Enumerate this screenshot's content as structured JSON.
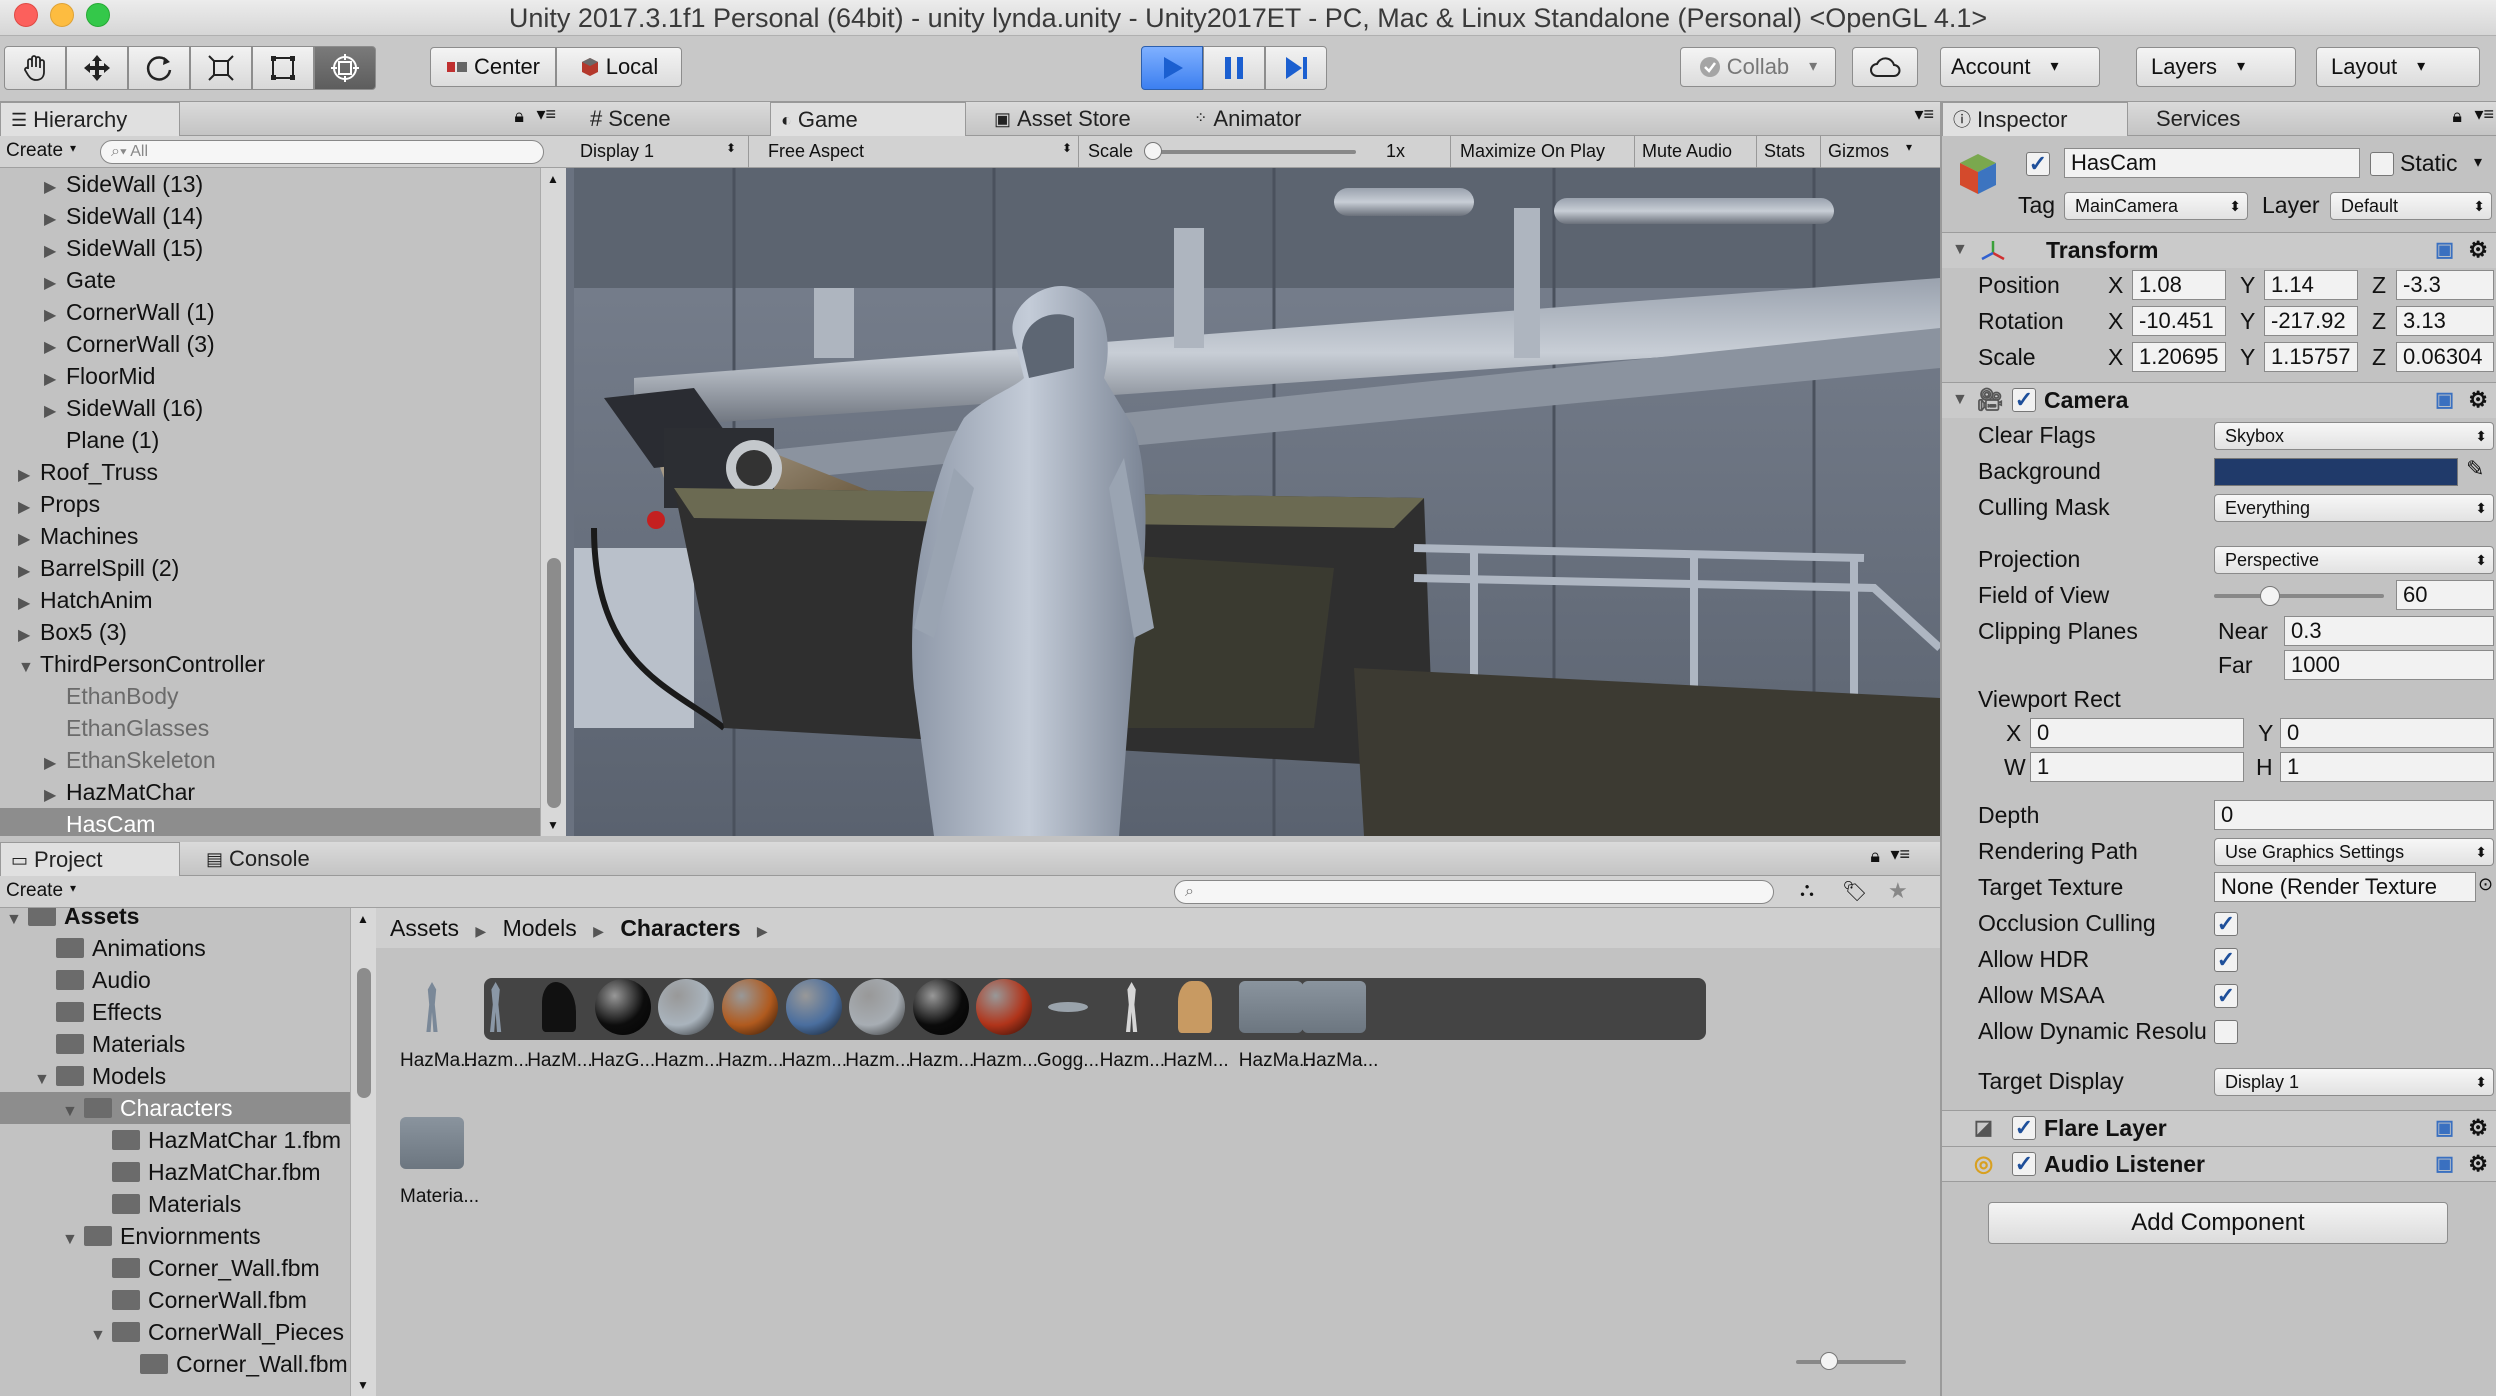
{
  "window": {
    "title": "Unity 2017.3.1f1 Personal (64bit) - unity lynda.unity - Unity2017ET - PC, Mac & Linux Standalone (Personal) <OpenGL 4.1>"
  },
  "toolbar": {
    "pivot_center": "Center",
    "pivot_local": "Local",
    "collab": "Collab",
    "account": "Account",
    "layers": "Layers",
    "layout": "Layout"
  },
  "hierarchy": {
    "tab": "Hierarchy",
    "create": "Create",
    "search_placeholder": "All",
    "items": [
      {
        "label": "SideWall (13)",
        "indent": 1,
        "arrow": true,
        "dim": false
      },
      {
        "label": "SideWall (14)",
        "indent": 1,
        "arrow": true,
        "dim": false
      },
      {
        "label": "SideWall (15)",
        "indent": 1,
        "arrow": true,
        "dim": false
      },
      {
        "label": "Gate",
        "indent": 1,
        "arrow": true,
        "dim": false
      },
      {
        "label": "CornerWall (1)",
        "indent": 1,
        "arrow": true,
        "dim": false
      },
      {
        "label": "CornerWall (3)",
        "indent": 1,
        "arrow": true,
        "dim": false
      },
      {
        "label": "FloorMid",
        "indent": 1,
        "arrow": true,
        "dim": false
      },
      {
        "label": "SideWall (16)",
        "indent": 1,
        "arrow": true,
        "dim": false
      },
      {
        "label": "Plane (1)",
        "indent": 1,
        "arrow": false,
        "dim": false
      },
      {
        "label": "Roof_Truss",
        "indent": 0,
        "arrow": true,
        "dim": false
      },
      {
        "label": "Props",
        "indent": 0,
        "arrow": true,
        "dim": false
      },
      {
        "label": "Machines",
        "indent": 0,
        "arrow": true,
        "dim": false
      },
      {
        "label": "BarrelSpill (2)",
        "indent": 0,
        "arrow": true,
        "dim": false
      },
      {
        "label": "HatchAnim",
        "indent": 0,
        "arrow": true,
        "dim": false
      },
      {
        "label": "Box5 (3)",
        "indent": 0,
        "arrow": true,
        "dim": false
      },
      {
        "label": "ThirdPersonController",
        "indent": 0,
        "arrow": true,
        "open": true,
        "dim": false
      },
      {
        "label": "EthanBody",
        "indent": 1,
        "arrow": false,
        "dim": true
      },
      {
        "label": "EthanGlasses",
        "indent": 1,
        "arrow": false,
        "dim": true
      },
      {
        "label": "EthanSkeleton",
        "indent": 1,
        "arrow": true,
        "dim": true
      },
      {
        "label": "HazMatChar",
        "indent": 1,
        "arrow": true,
        "dim": false
      },
      {
        "label": "HasCam",
        "indent": 1,
        "arrow": false,
        "dim": false,
        "selected": true
      }
    ]
  },
  "viewtabs": {
    "scene": "Scene",
    "game": "Game",
    "asset_store": "Asset Store",
    "animator": "Animator"
  },
  "gamebar": {
    "display": "Display 1",
    "aspect": "Free Aspect",
    "scale_label": "Scale",
    "scale_value": "1x",
    "maximize": "Maximize On Play",
    "mute": "Mute Audio",
    "stats": "Stats",
    "gizmos": "Gizmos"
  },
  "inspector": {
    "tab": "Inspector",
    "services_tab": "Services",
    "object_name": "HasCam",
    "static_label": "Static",
    "tag_label": "Tag",
    "tag_value": "MainCamera",
    "layer_label": "Layer",
    "layer_value": "Default",
    "transform": {
      "title": "Transform",
      "position_label": "Position",
      "position": {
        "x": "1.08",
        "y": "1.14",
        "z": "-3.3"
      },
      "rotation_label": "Rotation",
      "rotation": {
        "x": "-10.451",
        "y": "-217.92",
        "z": "3.13"
      },
      "scale_label": "Scale",
      "scale": {
        "x": "1.20695",
        "y": "1.15757",
        "z": "0.06304"
      }
    },
    "camera": {
      "title": "Camera",
      "clear_flags_label": "Clear Flags",
      "clear_flags": "Skybox",
      "background_label": "Background",
      "background_color": "#203a6a",
      "culling_mask_label": "Culling Mask",
      "culling_mask": "Everything",
      "projection_label": "Projection",
      "projection": "Perspective",
      "fov_label": "Field of View",
      "fov": "60",
      "fov_fraction": 0.33,
      "clipping_label": "Clipping Planes",
      "near_label": "Near",
      "near": "0.3",
      "far_label": "Far",
      "far": "1000",
      "viewport_label": "Viewport Rect",
      "vx": "0",
      "vy": "0",
      "vw": "1",
      "vh": "1",
      "depth_label": "Depth",
      "depth": "0",
      "rendering_path_label": "Rendering Path",
      "rendering_path": "Use Graphics Settings",
      "target_texture_label": "Target Texture",
      "target_texture": "None (Render Texture",
      "occlusion_label": "Occlusion Culling",
      "hdr_label": "Allow HDR",
      "msaa_label": "Allow MSAA",
      "dynamic_label": "Allow Dynamic Resolu",
      "target_display_label": "Target Display",
      "target_display": "Display 1"
    },
    "flare_layer": "Flare Layer",
    "audio_listener": "Audio Listener",
    "add_component": "Add Component"
  },
  "project": {
    "tab": "Project",
    "console_tab": "Console",
    "create": "Create",
    "tree": [
      {
        "label": "Assets",
        "indent": 0,
        "arrow": "open",
        "bold": true
      },
      {
        "label": "Animations",
        "indent": 1,
        "arrow": "none"
      },
      {
        "label": "Audio",
        "indent": 1,
        "arrow": "none"
      },
      {
        "label": "Effects",
        "indent": 1,
        "arrow": "none"
      },
      {
        "label": "Materials",
        "indent": 1,
        "arrow": "none"
      },
      {
        "label": "Models",
        "indent": 1,
        "arrow": "open"
      },
      {
        "label": "Characters",
        "indent": 2,
        "arrow": "open",
        "selected": true
      },
      {
        "label": "HazMatChar 1.fbm",
        "indent": 3,
        "arrow": "none"
      },
      {
        "label": "HazMatChar.fbm",
        "indent": 3,
        "arrow": "none"
      },
      {
        "label": "Materials",
        "indent": 3,
        "arrow": "none"
      },
      {
        "label": "Enviornments",
        "indent": 2,
        "arrow": "open"
      },
      {
        "label": "Corner_Wall.fbm",
        "indent": 3,
        "arrow": "none"
      },
      {
        "label": "CornerWall.fbm",
        "indent": 3,
        "arrow": "none"
      },
      {
        "label": "CornerWall_Pieces",
        "indent": 3,
        "arrow": "open"
      },
      {
        "label": "Corner_Wall.fbm",
        "indent": 4,
        "arrow": "none"
      }
    ],
    "breadcrumb": [
      "Assets",
      "Models",
      "Characters"
    ],
    "assets": [
      {
        "label": "HazMa...",
        "kind": "figure",
        "color": "#7a8898"
      },
      {
        "label": "Hazm...",
        "kind": "figure",
        "color": "#8a97a6"
      },
      {
        "label": "HazM...",
        "kind": "shape",
        "color": "#111111"
      },
      {
        "label": "HazG...",
        "kind": "sphere",
        "color": "#0d0d0d"
      },
      {
        "label": "Hazm...",
        "kind": "sphere",
        "color": "#a9b3bc"
      },
      {
        "label": "Hazm...",
        "kind": "sphere",
        "color": "#b05a1e"
      },
      {
        "label": "Hazm...",
        "kind": "sphere",
        "color": "#4a6e9e"
      },
      {
        "label": "Hazm...",
        "kind": "sphere",
        "color": "#a7adb3"
      },
      {
        "label": "Hazm...",
        "kind": "sphere",
        "color": "#0b0b0b"
      },
      {
        "label": "Hazm...",
        "kind": "sphere",
        "color": "#b0341a"
      },
      {
        "label": "Gogg...",
        "kind": "goggle",
        "color": "#9aa3ab"
      },
      {
        "label": "Hazm...",
        "kind": "figure",
        "color": "#d6d6d6"
      },
      {
        "label": "HazM...",
        "kind": "avatar",
        "color": "#c89a62"
      },
      {
        "label": "HazMa...",
        "kind": "folder",
        "color": "#6c7680"
      },
      {
        "label": "HazMa...",
        "kind": "folder",
        "color": "#6c7680"
      }
    ],
    "second_row": [
      {
        "label": "Materia...",
        "kind": "folder"
      }
    ]
  }
}
